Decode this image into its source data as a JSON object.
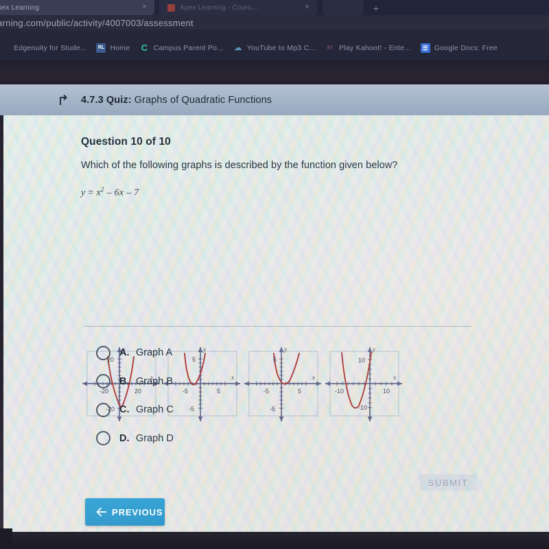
{
  "browser": {
    "tabs": [
      {
        "title": "Apex Learning",
        "favicon": "apex-favicon",
        "close": "×"
      },
      {
        "title": "Apex Learning - Cours...",
        "favicon": "apex-favicon-2",
        "close": "×"
      },
      {
        "title": "",
        "favicon": "blank-favicon",
        "close": ""
      }
    ],
    "new_tab_label": "+",
    "url": "arning.com/public/activity/4007003/assessment",
    "bookmarks": [
      {
        "label": "Edgenuity for Stude...",
        "icon": "edgenuity-icon",
        "icon_glyph": ""
      },
      {
        "label": "Home",
        "icon": "rl-icon",
        "icon_glyph": "RL"
      },
      {
        "label": "Campus Parent Po...",
        "icon": "campus-icon",
        "icon_glyph": "C"
      },
      {
        "label": "YouTube to Mp3 C...",
        "icon": "cloud-icon",
        "icon_glyph": "☁"
      },
      {
        "label": "Play Kahoot! - Ente...",
        "icon": "kahoot-icon",
        "icon_glyph": "K!"
      },
      {
        "label": "Google Docs: Free",
        "icon": "google-docs-icon",
        "icon_glyph": "☰"
      }
    ]
  },
  "quiz_header": {
    "back_icon": "back-arrow-icon",
    "number": "4.7.3",
    "kind": "Quiz:",
    "subject": "Graphs of Quadratic Functions"
  },
  "question": {
    "counter": "Question 10 of 10",
    "prompt": "Which of the following graphs is described by the function given below?",
    "function_y": "y",
    "function_eq": "=",
    "function_x": "x",
    "function_exp": "2",
    "function_rest": "– 6x – 7"
  },
  "answers": {
    "options": [
      {
        "letter": "A.",
        "text": "Graph A",
        "selected": false
      },
      {
        "letter": "B.",
        "text": "Graph B",
        "selected": false
      },
      {
        "letter": "C.",
        "text": "Graph C",
        "selected": false
      },
      {
        "letter": "D.",
        "text": "Graph D",
        "selected": false
      }
    ]
  },
  "footer": {
    "submit_label": "SUBMIT",
    "submit_enabled": false,
    "previous_label": "PREVIOUS",
    "previous_icon": "left-arrow-icon"
  },
  "colors": {
    "header_bar": "#a4b4c8",
    "previous_button": "#2391c8",
    "curve": "#a8332f",
    "axis": "#5a5f86",
    "graph_border": "#a9b6c9"
  },
  "chart_data": [
    {
      "id": "graph-a",
      "type": "line",
      "title": "Graph A",
      "xlabel": "x",
      "ylabel": "y",
      "xlim": [
        -30,
        30
      ],
      "ylim": [
        -30,
        30
      ],
      "xticks": [
        -20,
        20
      ],
      "yticks": [
        20,
        -20
      ],
      "xtick_labels": [
        "-20",
        "20"
      ],
      "ytick_labels": [
        "20",
        "-20"
      ],
      "grid": false,
      "function": "y = x^2 - 6x - 7",
      "vertex": [
        3,
        -16
      ],
      "roots": [
        -1,
        7
      ],
      "note": "narrow upward parabola, vertex near (3,-16) on a -30..30 window"
    },
    {
      "id": "graph-b",
      "type": "line",
      "title": "Graph B",
      "xlabel": "x",
      "ylabel": "y",
      "xlim": [
        -8,
        8
      ],
      "ylim": [
        -8,
        8
      ],
      "xticks": [
        -5,
        5
      ],
      "yticks": [
        5,
        -5
      ],
      "xtick_labels": [
        "-5",
        "5"
      ],
      "ytick_labels": [
        "5",
        "-5"
      ],
      "grid": false,
      "vertex": [
        -1,
        -0.5
      ],
      "roots": [
        -1.6,
        -0.4
      ],
      "note": "narrow upward parabola shifted left, vertex near (-1,-0.5)"
    },
    {
      "id": "graph-c",
      "type": "line",
      "title": "Graph C",
      "xlabel": "x",
      "ylabel": "y",
      "xlim": [
        -8,
        8
      ],
      "ylim": [
        -8,
        8
      ],
      "xticks": [
        -5,
        5
      ],
      "yticks": [
        5,
        -5
      ],
      "xtick_labels": [
        "-5",
        "5"
      ],
      "ytick_labels": [
        "5",
        "-5"
      ],
      "grid": false,
      "vertex": [
        1,
        0
      ],
      "roots": [
        1
      ],
      "note": "upward parabola tangent to x-axis at x=1"
    },
    {
      "id": "graph-d",
      "type": "line",
      "title": "Graph D",
      "xlabel": "x",
      "ylabel": "y",
      "xlim": [
        -16,
        16
      ],
      "ylim": [
        -16,
        16
      ],
      "xticks": [
        -10,
        10
      ],
      "yticks": [
        10,
        -10
      ],
      "xtick_labels": [
        "-10",
        "10"
      ],
      "ytick_labels": [
        "10",
        "-10"
      ],
      "grid": false,
      "vertex": [
        -3,
        -16
      ],
      "roots": [
        -7,
        1
      ],
      "note": "upward parabola vertex near (-3,-16), roots -7 and 1"
    }
  ]
}
